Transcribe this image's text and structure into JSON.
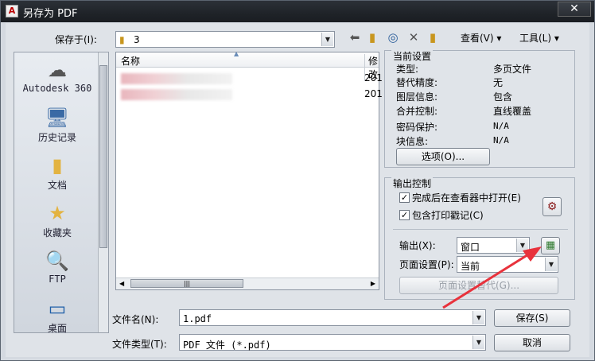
{
  "window": {
    "title": "另存为 PDF",
    "close_glyph": "✕"
  },
  "toolbar": {
    "save_in_label": "保存于(I):",
    "save_in_value": "3",
    "view_label": "查看(V)",
    "tools_label": "工具(L)"
  },
  "places": [
    {
      "label": "Autodesk 360",
      "icon": "cloud-icon"
    },
    {
      "label": "历史记录",
      "icon": "history-icon"
    },
    {
      "label": "文档",
      "icon": "documents-icon"
    },
    {
      "label": "收藏夹",
      "icon": "favorites-icon"
    },
    {
      "label": "FTP",
      "icon": "ftp-icon"
    },
    {
      "label": "桌面",
      "icon": "desktop-icon"
    }
  ],
  "file_list": {
    "col_name": "名称",
    "col_modified": "修改",
    "rows": [
      {
        "date_fragment": "201"
      },
      {
        "date_fragment": "201"
      }
    ]
  },
  "current_settings": {
    "title": "当前设置",
    "items": [
      {
        "label": "类型:",
        "value": "多页文件"
      },
      {
        "label": "替代精度:",
        "value": "无"
      },
      {
        "label": "图层信息:",
        "value": "包含"
      },
      {
        "label": "合并控制:",
        "value": "直线覆盖"
      },
      {
        "label": "密码保护:",
        "value": "N/A"
      },
      {
        "label": "块信息:",
        "value": "N/A"
      }
    ],
    "options_button": "选项(O)..."
  },
  "output_control": {
    "title": "输出控制",
    "open_in_viewer": "完成后在查看器中打开(E)",
    "include_plot_stamp": "包含打印戳记(C)",
    "output_label": "输出(X):",
    "output_value": "窗口",
    "page_setup_label": "页面设置(P):",
    "page_setup_value": "当前",
    "page_setup_override": "页面设置替代(G)..."
  },
  "bottom": {
    "filename_label": "文件名(N):",
    "filename_value": "1.pdf",
    "filetype_label": "文件类型(T):",
    "filetype_value": "PDF 文件 (*.pdf)",
    "save_button": "保存(S)",
    "cancel_button": "取消"
  },
  "colors": {
    "title_bar": "#1f2328",
    "annotation_arrow": "#e8323c"
  }
}
